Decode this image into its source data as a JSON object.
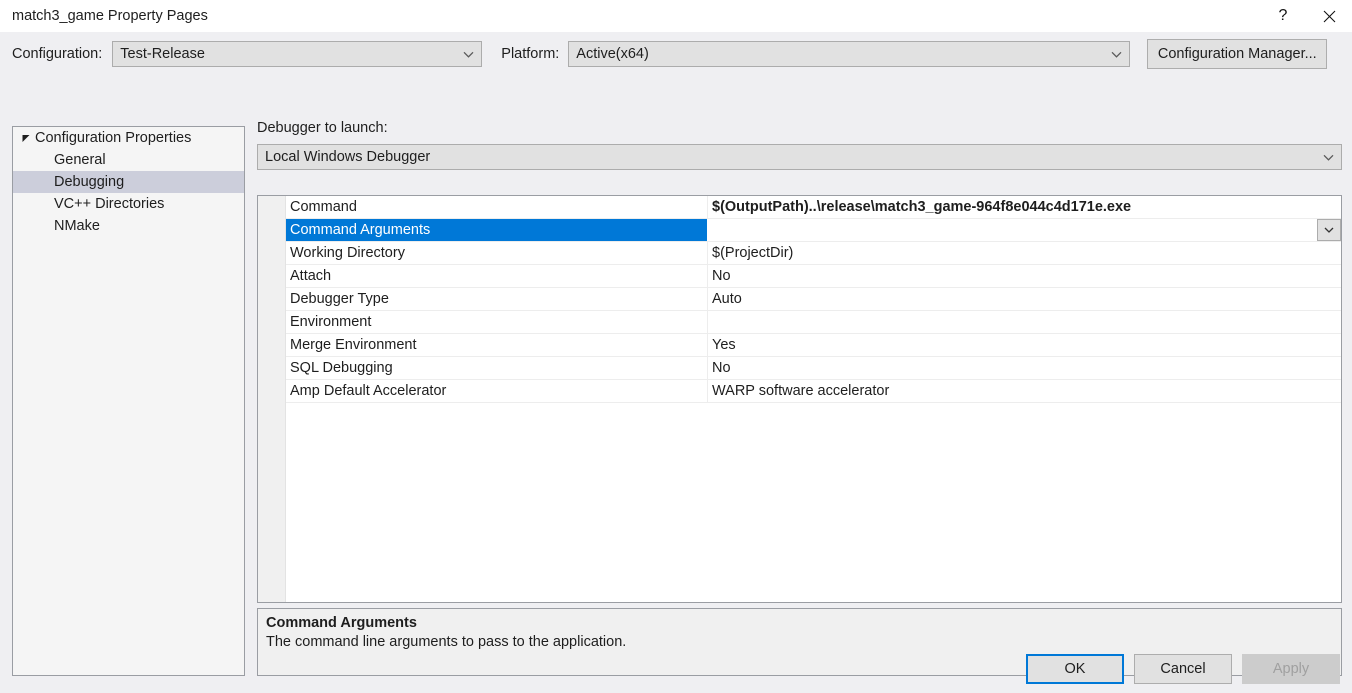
{
  "window": {
    "title": "match3_game Property Pages",
    "help_icon": "question-mark-icon",
    "close_icon": "close-icon"
  },
  "configbar": {
    "configuration_label": "Configuration:",
    "configuration_value": "Test-Release",
    "platform_label": "Platform:",
    "platform_value": "Active(x64)",
    "configuration_manager_label": "Configuration Manager...",
    "chevron_icon": "chevron-down-icon"
  },
  "tree": {
    "root": {
      "label": "Configuration Properties",
      "expander_icon": "triangle-expanded-icon",
      "expanded": true
    },
    "items": [
      {
        "label": "General",
        "selected": false
      },
      {
        "label": "Debugging",
        "selected": true
      },
      {
        "label": "VC++ Directories",
        "selected": false
      },
      {
        "label": "NMake",
        "selected": false
      }
    ]
  },
  "main": {
    "debugger_label": "Debugger to launch:",
    "debugger_value": "Local Windows Debugger",
    "properties": [
      {
        "name": "Command",
        "value": "$(OutputPath)..\\release\\match3_game-964f8e044c4d171e.exe",
        "bold": true,
        "selected": false,
        "has_dropdown": false
      },
      {
        "name": "Command Arguments",
        "value": "",
        "bold": false,
        "selected": true,
        "has_dropdown": true
      },
      {
        "name": "Working Directory",
        "value": "$(ProjectDir)",
        "bold": false,
        "selected": false,
        "has_dropdown": false
      },
      {
        "name": "Attach",
        "value": "No",
        "bold": false,
        "selected": false,
        "has_dropdown": false
      },
      {
        "name": "Debugger Type",
        "value": "Auto",
        "bold": false,
        "selected": false,
        "has_dropdown": false
      },
      {
        "name": "Environment",
        "value": "",
        "bold": false,
        "selected": false,
        "has_dropdown": false
      },
      {
        "name": "Merge Environment",
        "value": "Yes",
        "bold": false,
        "selected": false,
        "has_dropdown": false
      },
      {
        "name": "SQL Debugging",
        "value": "No",
        "bold": false,
        "selected": false,
        "has_dropdown": false
      },
      {
        "name": "Amp Default Accelerator",
        "value": "WARP software accelerator",
        "bold": false,
        "selected": false,
        "has_dropdown": false
      }
    ],
    "description": {
      "title": "Command Arguments",
      "text": "The command line arguments to pass to the application."
    }
  },
  "footer": {
    "ok_label": "OK",
    "cancel_label": "Cancel",
    "apply_label": "Apply",
    "apply_disabled": true
  },
  "colors": {
    "dialog_background": "#EFEFF2",
    "selection_blue": "#0078D7",
    "tree_selection": "#CCCEDB",
    "panel_background": "#F0F0F0",
    "border": "#9A9DA3"
  }
}
